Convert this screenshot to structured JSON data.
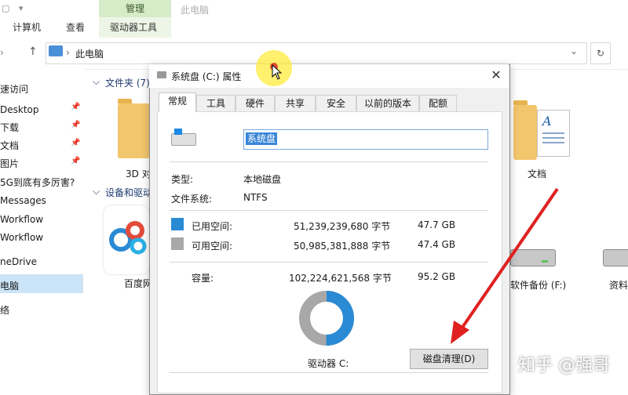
{
  "window": {
    "title_faded": "此电脑",
    "ribbon_tabs": [
      "计算机",
      "查看"
    ],
    "contextual_tab_header": "管理",
    "contextual_tab": "驱动器工具"
  },
  "address": {
    "path": "此电脑",
    "refresh_icon": "refresh-icon"
  },
  "sidebar": {
    "items": [
      {
        "label": "速访问",
        "pinned": false
      },
      {
        "label": "Desktop",
        "pinned": true
      },
      {
        "label": "下载",
        "pinned": true
      },
      {
        "label": "文档",
        "pinned": true
      },
      {
        "label": "图片",
        "pinned": true
      },
      {
        "label": "5G到底有多厉害?",
        "pinned": false
      },
      {
        "label": "Messages",
        "pinned": false
      },
      {
        "label": "Workflow",
        "pinned": false
      },
      {
        "label": "Workflow",
        "pinned": false
      },
      {
        "label": "neDrive",
        "pinned": false
      },
      {
        "label": "电脑",
        "pinned": false
      },
      {
        "label": "络",
        "pinned": false
      }
    ],
    "selected_index": 10
  },
  "content": {
    "folders_header": "文件夹 (7)",
    "devices_header": "设备和驱动",
    "folder_3d": "3D 对",
    "folder_docs": "文档",
    "app_baidu": "百度网",
    "drive_f": "软件备份 (F:)",
    "drive_other": "资料"
  },
  "dialog": {
    "title": "系统盘 (C:) 属性",
    "tabs": [
      "常规",
      "工具",
      "硬件",
      "共享",
      "安全",
      "以前的版本",
      "配额"
    ],
    "active_tab": "常规",
    "name_value": "系统盘",
    "type_label": "类型:",
    "type_value": "本地磁盘",
    "fs_label": "文件系统:",
    "fs_value": "NTFS",
    "used": {
      "label": "已用空间:",
      "bytes": "51,239,239,680 字节",
      "size": "47.7 GB",
      "color": "#2a8ad4"
    },
    "free": {
      "label": "可用空间:",
      "bytes": "50,985,381,888 字节",
      "size": "47.4 GB",
      "color": "#a8a8a8"
    },
    "capacity": {
      "label": "容量:",
      "bytes": "102,224,621,568 字节",
      "size": "95.2 GB"
    },
    "drive_caption": "驱动器 C:",
    "cleanup_button": "磁盘清理(D)",
    "used_fraction": 0.5012
  },
  "overlay": {
    "watermark": "知乎 @强哥",
    "arrow_color": "#e02020",
    "cursor_highlight": "#ffeb3c"
  }
}
